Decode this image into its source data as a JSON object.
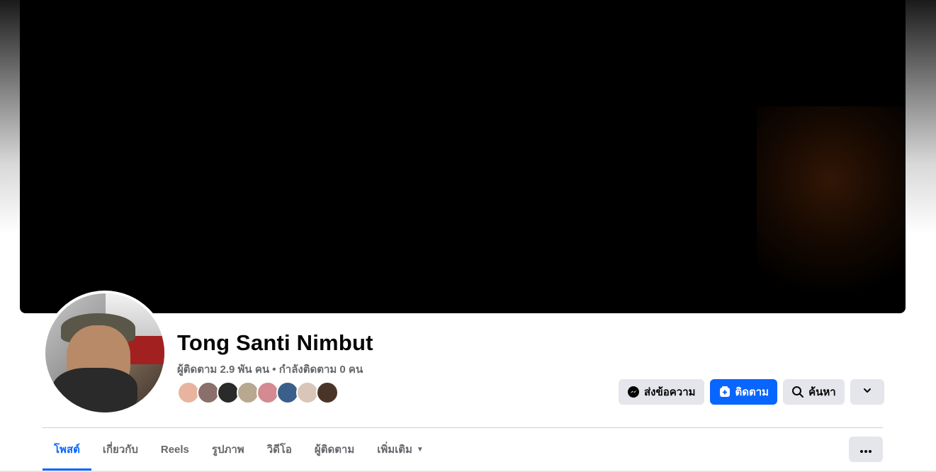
{
  "profile": {
    "name": "Tong Santi Nimbut",
    "stats": "ผู้ติดตาม 2.9 พัน คน • กำลังติดตาม 0 คน"
  },
  "friends_preview": {
    "colors": [
      "#e8b4a0",
      "#8a6f6a",
      "#2a2a2a",
      "#b9a890",
      "#d38a90",
      "#3a5f8a",
      "#d9c6b8",
      "#4a3428"
    ]
  },
  "actions": {
    "message_label": "ส่งข้อความ",
    "follow_label": "ติดตาม",
    "search_label": "ค้นหา"
  },
  "tabs": [
    {
      "label": "โพสต์",
      "active": true
    },
    {
      "label": "เกี่ยวกับ"
    },
    {
      "label": "Reels"
    },
    {
      "label": "รูปภาพ"
    },
    {
      "label": "วิดีโอ"
    },
    {
      "label": "ผู้ติดตาม"
    },
    {
      "label": "เพิ่มเติม"
    }
  ],
  "icons": {
    "message": "messenger-icon",
    "follow": "follow-plus-icon",
    "search": "search-icon",
    "dropdown": "chevron-down-icon",
    "more": "more-dots-icon"
  },
  "colors": {
    "accent": "#0866ff",
    "button_bg": "#e4e6eb",
    "secondary_text": "#65676b"
  }
}
